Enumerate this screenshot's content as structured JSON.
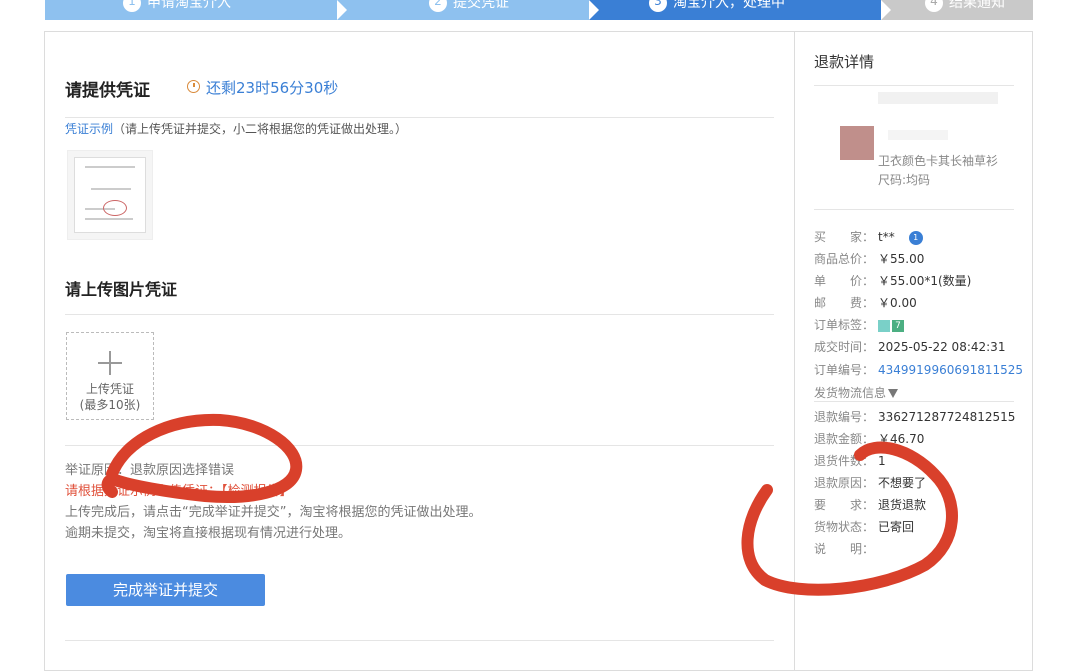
{
  "steps": [
    {
      "num": "1",
      "label": "申请淘宝介入"
    },
    {
      "num": "2",
      "label": "提交凭证"
    },
    {
      "num": "3",
      "label": "淘宝介入，处理中"
    },
    {
      "num": "4",
      "label": "结果通知"
    }
  ],
  "evidence": {
    "title": "请提供凭证",
    "timer": "还剩23时56分30秒",
    "sample_link": "凭证示例",
    "sample_hint": "（请上传凭证并提交，小二将根据您的凭证做出处理。）",
    "upload_title": "请上传图片凭证",
    "upload_label": "上传凭证",
    "upload_limit": "(最多10张)",
    "reason_label": "举证原因：",
    "reason_value": "退款原因选择错误",
    "note_sample": "请根据凭证示例上传凭证：【检测报告】",
    "note_submit": "上传完成后，请点击“完成举证并提交”，淘宝将根据您的凭证做出处理。",
    "note_overdue": "逾期未提交，淘宝将直接根据现有情况进行处理。",
    "submit_label": "完成举证并提交"
  },
  "refund": {
    "title": "退款详情",
    "product_name": "卫衣颜色卡其长袖草衫",
    "product_size": "尺码:均码",
    "rows": [
      {
        "k": "买　　家：",
        "v": "t**"
      },
      {
        "k": "商品总价：",
        "v": "￥55.00"
      },
      {
        "k": "单　　价：",
        "v": "￥55.00*1(数量)"
      },
      {
        "k": "邮　　费：",
        "v": "￥0.00"
      },
      {
        "k": "订单标签：",
        "v": ""
      },
      {
        "k": "成交时间：",
        "v": "2025-05-22 08:42:31"
      },
      {
        "k": "订单编号：",
        "v": "4349919960691811525"
      },
      {
        "k": "退款编号：",
        "v": "336271287724812515"
      },
      {
        "k": "退款金额：",
        "v": "￥46.70"
      },
      {
        "k": "退货件数：",
        "v": "1"
      },
      {
        "k": "退款原因：",
        "v": "不想要了"
      },
      {
        "k": "要　　求：",
        "v": "退货退款"
      },
      {
        "k": "货物状态：",
        "v": "已寄回"
      },
      {
        "k": "说　　明：",
        "v": ""
      }
    ],
    "logistics_label": "发货物流信息",
    "tag2": "7"
  },
  "colors": {
    "primary": "#3a7fd5",
    "button": "#4b8be0",
    "annotation": "#d9402b"
  }
}
